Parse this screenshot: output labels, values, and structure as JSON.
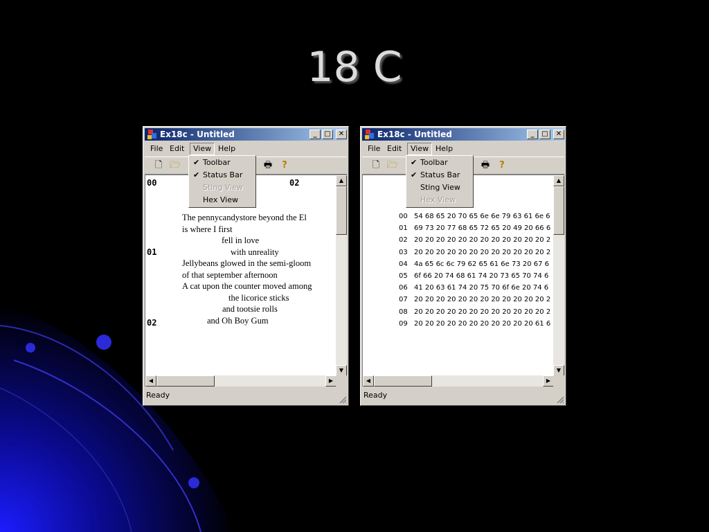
{
  "slide": {
    "title": "18 C"
  },
  "colors": {
    "desktop": "#000000",
    "titlebar_start": "#0a246a",
    "titlebar_end": "#a6caf0",
    "window_face": "#d4d0c8",
    "swoosh": "#1a1aff"
  },
  "windows": [
    {
      "title": "Ex18c - Untitled",
      "menu": {
        "file": "File",
        "edit": "Edit",
        "view": "View",
        "help": "Help"
      },
      "view_menu": [
        {
          "label": "Toolbar",
          "checked": "✔",
          "disabled": false
        },
        {
          "label": "Status Bar",
          "checked": "✔",
          "disabled": false
        },
        {
          "label": "Sting View",
          "checked": "",
          "disabled": true
        },
        {
          "label": "Hex View",
          "checked": "",
          "disabled": false
        }
      ],
      "status": "Ready",
      "page_markers": {
        "m00": "00",
        "m01": "01",
        "m02": "02",
        "m02_right": "02"
      },
      "poem": [
        "The pennycandystore beyond the El",
        "is where I first",
        "fell in love",
        "with unreality",
        "Jellybeans glowed in the semi-gloom",
        "of that september afternoon",
        "A cat upon the counter moved among",
        "the licorice sticks",
        "and tootsie rolls",
        "and Oh Boy Gum"
      ]
    },
    {
      "title": "Ex18c - Untitled",
      "menu": {
        "file": "File",
        "edit": "Edit",
        "view": "View",
        "help": "Help"
      },
      "view_menu": [
        {
          "label": "Toolbar",
          "checked": "✔",
          "disabled": false
        },
        {
          "label": "Status Bar",
          "checked": "✔",
          "disabled": false
        },
        {
          "label": "Sting View",
          "checked": "",
          "disabled": false
        },
        {
          "label": "Hex View",
          "checked": "",
          "disabled": true
        }
      ],
      "status": "Ready",
      "hex_rows": [
        {
          "offset": "00",
          "bytes": "54 68 65 20 70 65 6e 6e 79 63 61 6e 6"
        },
        {
          "offset": "01",
          "bytes": "69 73 20 77 68 65 72 65 20 49 20 66 6"
        },
        {
          "offset": "02",
          "bytes": "20 20 20 20 20 20 20 20 20 20 20 20 2"
        },
        {
          "offset": "03",
          "bytes": "20 20 20 20 20 20 20 20 20 20 20 20 2"
        },
        {
          "offset": "04",
          "bytes": "4a 65 6c 6c 79 62 65 61 6e 73 20 67 6"
        },
        {
          "offset": "05",
          "bytes": "6f 66 20 74 68 61 74 20 73 65 70 74 6"
        },
        {
          "offset": "06",
          "bytes": "41 20 63 61 74 20 75 70 6f 6e 20 74 6"
        },
        {
          "offset": "07",
          "bytes": "20 20 20 20 20 20 20 20 20 20 20 20 2"
        },
        {
          "offset": "08",
          "bytes": "20 20 20 20 20 20 20 20 20 20 20 20 2"
        },
        {
          "offset": "09",
          "bytes": "20 20 20 20 20 20 20 20 20 20 20 61 6"
        }
      ]
    }
  ],
  "icons": [
    "app-icon",
    "minimize-icon",
    "maximize-icon",
    "close-icon",
    "new-file-icon",
    "open-folder-icon",
    "print-icon",
    "help-icon",
    "scroll-up-icon",
    "scroll-down-icon",
    "scroll-left-icon",
    "scroll-right-icon",
    "size-grip-icon"
  ]
}
